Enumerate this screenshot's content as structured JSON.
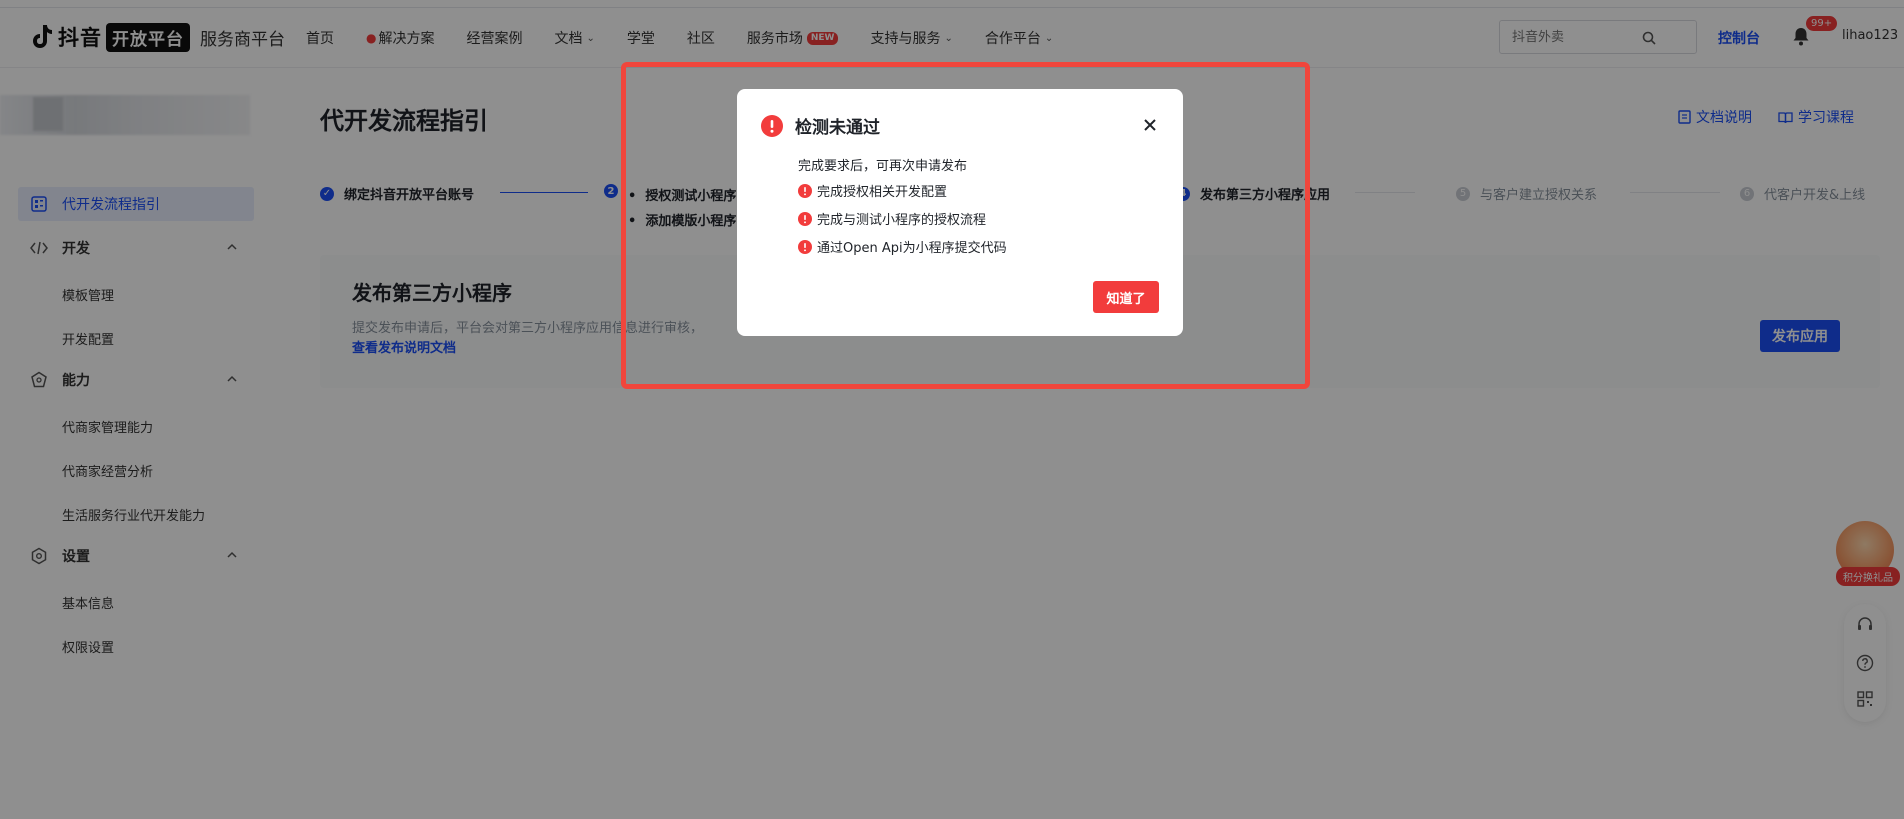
{
  "header": {
    "brand": "抖音",
    "platform_pill": "开放平台",
    "subtitle": "服务商平台",
    "nav": [
      {
        "label": "首页",
        "icon": "",
        "chevron": false,
        "tag": ""
      },
      {
        "label": "解决方案",
        "icon": "fire-icon",
        "chevron": false,
        "tag": ""
      },
      {
        "label": "经营案例",
        "icon": "",
        "chevron": false,
        "tag": ""
      },
      {
        "label": "文档",
        "icon": "",
        "chevron": true,
        "tag": ""
      },
      {
        "label": "学堂",
        "icon": "",
        "chevron": false,
        "tag": ""
      },
      {
        "label": "社区",
        "icon": "",
        "chevron": false,
        "tag": ""
      },
      {
        "label": "服务市场",
        "icon": "",
        "chevron": false,
        "tag": "NEW"
      },
      {
        "label": "支持与服务",
        "icon": "",
        "chevron": true,
        "tag": ""
      },
      {
        "label": "合作平台",
        "icon": "",
        "chevron": true,
        "tag": ""
      }
    ],
    "search_placeholder": "抖音外卖",
    "console_label": "控制台",
    "notification_badge": "99+",
    "username": "lihao123"
  },
  "sidebar": {
    "active_item": "代开发流程指引",
    "groups": [
      {
        "label": "开发",
        "items": [
          "模板管理",
          "开发配置"
        ]
      },
      {
        "label": "能力",
        "items": [
          "代商家管理能力",
          "代商家经营分析",
          "生活服务行业代开发能力"
        ]
      },
      {
        "label": "设置",
        "items": [
          "基本信息",
          "权限设置"
        ]
      }
    ]
  },
  "main": {
    "title": "代开发流程指引",
    "links": [
      "文档说明",
      "学习课程"
    ],
    "steps": [
      {
        "num": "1",
        "label": "绑定抖音开放平台账号",
        "state": "done"
      },
      {
        "num": "2",
        "label": "授权测试小程序",
        "state": "current"
      },
      {
        "num": "4",
        "label": "发布第三方小程序应用",
        "state": "current"
      },
      {
        "num": "5",
        "label": "与客户建立授权关系",
        "state": "todo"
      },
      {
        "num": "6",
        "label": "代客户开发&上线",
        "state": "todo"
      }
    ],
    "substeps": [
      "授权测试小程序",
      "添加模版小程序"
    ],
    "card": {
      "title": "发布第三方小程序",
      "desc": "提交发布申请后，平台会对第三方小程序应用信息进行审核，",
      "link": "查看发布说明文档",
      "button": "发布应用"
    }
  },
  "widgets": {
    "gift_label": "积分换礼品"
  },
  "modal": {
    "title": "检测未通过",
    "desc": "完成要求后，可再次申请发布",
    "items": [
      "完成授权相关开发配置",
      "完成与测试小程序的授权流程",
      "通过Open Api为小程序提交代码"
    ],
    "ok_button": "知道了"
  },
  "colors": {
    "primary": "#1b4ff7",
    "danger": "#f23c3c",
    "highlight_border": "#f0463c"
  }
}
